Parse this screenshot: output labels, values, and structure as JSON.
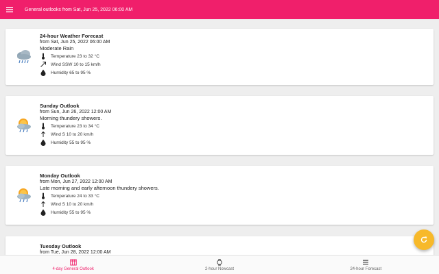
{
  "appbar": {
    "title": "General outlooks from Sat, Jun 25, 2022 06:00 AM",
    "menu_icon": "menu-icon"
  },
  "colors": {
    "primary": "#f01f6b",
    "accent": "#f7b92a"
  },
  "cards": [
    {
      "title": "24-hour Weather Forecast",
      "from": "from Sat, Jun 25, 2022 06:00 AM",
      "description": "Moderate Rain",
      "icon": "rain-cloud-icon",
      "temperature": "Temperature 23 to 32 °C",
      "wind": "Wind SSW 10 to 15 km/h",
      "humidity": "Humidity 65 to 95 %"
    },
    {
      "title": "Sunday Outlook",
      "from": "from Sun, Jun 26, 2022 12:00 AM",
      "description": "Morning thundery showers.",
      "icon": "sun-cloud-rain-icon",
      "temperature": "Temperature 23 to 34 °C",
      "wind": "Wind S 10 to 20 km/h",
      "humidity": "Humidity 55 to 95 %"
    },
    {
      "title": "Monday Outlook",
      "from": "from Mon, Jun 27, 2022 12:00 AM",
      "description": "Late morning and early afternoon thundery showers.",
      "icon": "sun-cloud-rain-icon",
      "temperature": "Temperature 24 to 33 °C",
      "wind": "Wind S 10 to 20 km/h",
      "humidity": "Humidity 55 to 95 %"
    },
    {
      "title": "Tuesday Outlook",
      "from": "from Tue, Jun 28, 2022 12:00 AM"
    }
  ],
  "fab": {
    "icon": "refresh-icon"
  },
  "bottom_nav": [
    {
      "label": "4-day General Outlook",
      "icon": "calendar-icon",
      "active": true
    },
    {
      "label": "2-hour Nowcast",
      "icon": "watch-icon",
      "active": false
    },
    {
      "label": "24-hour Forecast",
      "icon": "list-icon",
      "active": false
    }
  ]
}
